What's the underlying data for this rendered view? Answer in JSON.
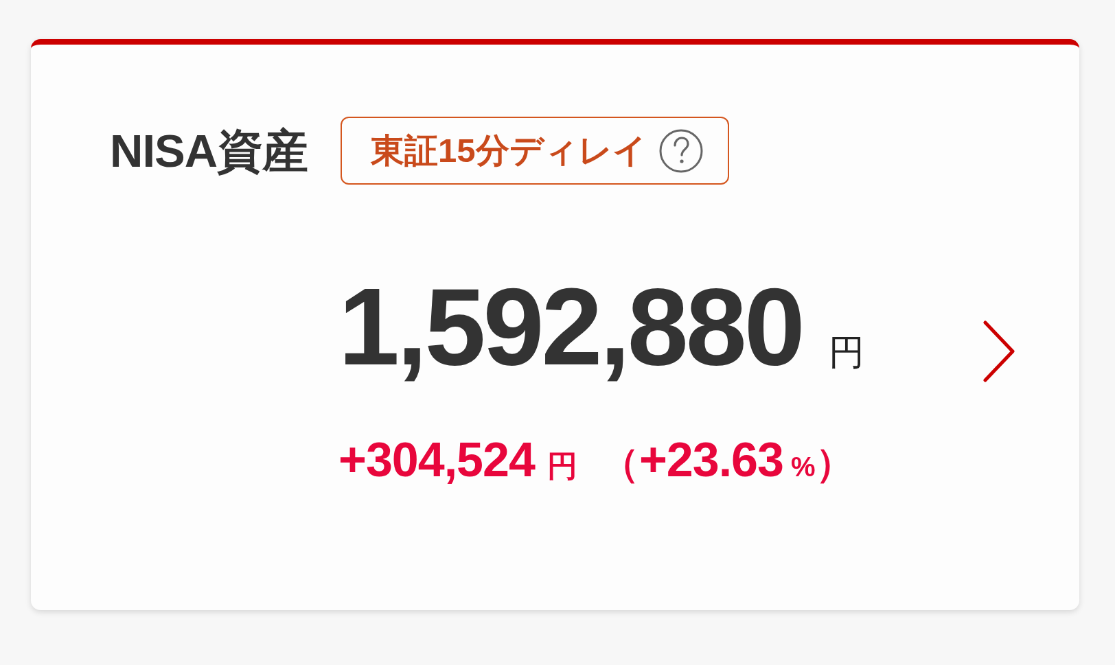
{
  "card": {
    "title": "NISA資産",
    "delay_badge": {
      "label": "東証15分ディレイ"
    },
    "total": {
      "amount": "1,592,880",
      "unit": "円"
    },
    "change": {
      "amount": "+304,524",
      "unit": "円",
      "percent_open": "（",
      "percent": "+23.63",
      "percent_unit": "%",
      "percent_close": "）"
    }
  }
}
